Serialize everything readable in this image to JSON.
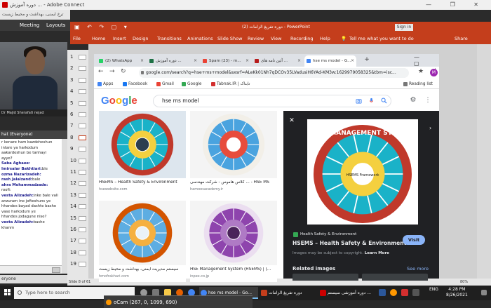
{
  "adobe_connect": {
    "title": "دوره آموزش ... - Adobe Connect",
    "url_strip": "ترخ ایمنی، بهداشت و محیط زیست",
    "menu": [
      "Meeting",
      "Layouts"
    ],
    "video_name": "Dr Majid Sherafati nejad",
    "chat_header": "hat (Everyone)",
    "chat_messages": [
      {
        "who": "",
        "text": "r kenare ham bazdeheshun"
      },
      {
        "who": "",
        "text": "intare ya harkodum"
      },
      {
        "who": "",
        "text": "aakardeshun be tanhayi"
      },
      {
        "who": "",
        "text": "ayye?"
      },
      {
        "who": "Saba Aghaee:",
        "text": ""
      },
      {
        "who": "Imirsalar Bakhtiari:",
        "text": "ble"
      },
      {
        "who": "ozma Nazarizadeh:",
        "text": ""
      },
      {
        "who": "rash Jalalzand:",
        "text": "bale"
      },
      {
        "who": "ahra Mohammadzade:",
        "text": ""
      },
      {
        "who": "",
        "text": "roofi:"
      },
      {
        "who": "vesta Alizadeh:",
        "text": "inke bale vali"
      },
      {
        "who": "",
        "text": "anzuram ine jofteshuns ye"
      },
      {
        "who": "",
        "text": "hhandes bayad dashte bashe"
      },
      {
        "who": "",
        "text": "vase harkodum ye"
      },
      {
        "who": "",
        "text": "hhandes jodagune nise?"
      },
      {
        "who": "vesta Alizadeh:",
        "text": "bashe"
      },
      {
        "who": "",
        "text": "khanm"
      }
    ],
    "bottom_label": "eryone"
  },
  "powerpoint": {
    "title": "دوره تفریغ الزامات (2)  -  PowerPoint",
    "sign_in": "Sign in",
    "tabs": [
      "File",
      "Home",
      "Insert",
      "Design",
      "Transitions",
      "Animations",
      "Slide Show",
      "Review",
      "View",
      "Recording",
      "Help"
    ],
    "tell_me": "Tell me what you want to do",
    "share": "Share",
    "slide_numbers": [
      "1",
      "2",
      "3",
      "4",
      "5",
      "6",
      "7",
      "8",
      "9",
      "10",
      "11",
      "12",
      "13",
      "14",
      "15",
      "16",
      "17",
      "18",
      "19"
    ],
    "status_slide": "Slide 8 of 61",
    "zoom": "80%"
  },
  "chrome": {
    "tabs": [
      {
        "label": "(2) WhatsApp",
        "color": "#25d366"
      },
      {
        "label": "دوره آموزش ...",
        "color": "#1e7145"
      },
      {
        "label": "Spam (23) - m...",
        "color": "#ea4335"
      },
      {
        "label": "آئین نامه های ...",
        "color": "#b71c1c"
      },
      {
        "label": "hse ms model - G...",
        "color": "#4285f4"
      }
    ],
    "url": "google.com/search?q=hse+ms+model&sxsrf=ALeKk01Nh7qDCOv35LVadusiH6YAd-KM3w:1629979058325&tbm=isc...",
    "profile_initial": "M",
    "bookmarks": [
      {
        "label": "Apps",
        "color": "#4285f4"
      },
      {
        "label": "Facebook",
        "color": "#1877f2"
      },
      {
        "label": "Gmail",
        "color": "#ea4335"
      },
      {
        "label": "Google",
        "color": "#34a853"
      },
      {
        "label": "Tabnak.IR | تابناک",
        "color": "#d32f2f"
      }
    ],
    "reading_list": "Reading list"
  },
  "google": {
    "logo_letters": [
      {
        "c": "G",
        "color": "#4285f4"
      },
      {
        "c": "o",
        "color": "#ea4335"
      },
      {
        "c": "o",
        "color": "#fbbc05"
      },
      {
        "c": "g",
        "color": "#4285f4"
      },
      {
        "c": "l",
        "color": "#34a853"
      },
      {
        "c": "e",
        "color": "#ea4335"
      }
    ],
    "query": "hse ms model",
    "results": [
      {
        "title": "HSEMS – Health Safety & Environment",
        "source": "hsewebsite.com"
      },
      {
        "title": "کلاس هاموس - شرکت مهندسی ... - HSE MS",
        "source": "hamoosacademy.ir"
      },
      {
        "title": "سیستم مدیریت ایمنی، بهداشت و محیط زیست",
        "source": "hmofrakhari.com"
      },
      {
        "title": "HSE Management System (HSEMS) | (...",
        "source": "inpex.co.jp"
      }
    ],
    "preview": {
      "source": "Health Safety & Environment",
      "title": "HSEMS – Health Safety & Environment",
      "copyright": "Images may be subject to copyright.",
      "learn_more": "Learn More",
      "visit": "Visit",
      "related": "Related images",
      "see_more": "See more",
      "image_heading": "HSE MANAGEMENT SYSTEM",
      "image_center": "HSEMS Framework"
    }
  },
  "taskbar": {
    "search_placeholder": "Type here to search",
    "apps": [
      {
        "label": "hse ms model - Go...",
        "color": "#4285f4"
      },
      {
        "label": "دوره تفریغ الزامات",
        "color": "#c43e1c"
      },
      {
        "label": "دوره آموزشی سیستم ...",
        "color": "#c00"
      }
    ],
    "lang": "ENG",
    "time": "4:28 PM",
    "date": "8/26/2021"
  },
  "ocam": {
    "label": "oCam (267, 0, 1099, 690)"
  }
}
